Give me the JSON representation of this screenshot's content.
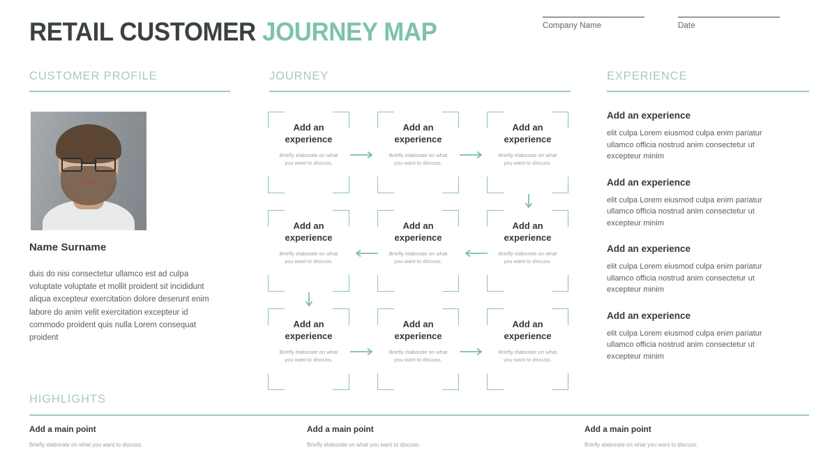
{
  "colors": {
    "accent": "#7dc3a8",
    "accent_line": "#9cccba",
    "bracket": "#8cc4ad",
    "heading_dark": "#3a4145",
    "body_text": "#555c60",
    "muted_text": "#9aa0a3",
    "background": "#ffffff"
  },
  "header": {
    "title_dark": "RETAIL CUSTOMER",
    "title_accent": "JOURNEY MAP",
    "fields": [
      {
        "label": "Company Name",
        "value": ""
      },
      {
        "label": "Date",
        "value": ""
      }
    ]
  },
  "profile": {
    "section_title": "CUSTOMER PROFILE",
    "photo_alt": "portrait-photo",
    "name": "Name Surname",
    "body": "duis do nisi consectetur ullamco est ad culpa voluptate voluptate et mollit proident sit incididunt aliqua excepteur exercitation dolore deserunt enim labore do anim velit exercitation excepteur id commodo proident quis nulla Lorem consequat proident"
  },
  "journey": {
    "section_title": "JOURNEY",
    "box_title": "Add an experience",
    "box_desc": "Briefly elaborate on what you want to discuss.",
    "boxes": [
      {
        "id": "j1",
        "title": "Add an experience",
        "desc": "Briefly elaborate on what you want to discuss."
      },
      {
        "id": "j2",
        "title": "Add an experience",
        "desc": "Briefly elaborate on what you want to discuss."
      },
      {
        "id": "j3",
        "title": "Add an experience",
        "desc": "Briefly elaborate on what you want to discuss."
      },
      {
        "id": "j4",
        "title": "Add an experience",
        "desc": "Briefly elaborate on what you want to discuss."
      },
      {
        "id": "j5",
        "title": "Add an experience",
        "desc": "Briefly elaborate on what you want to discuss."
      },
      {
        "id": "j6",
        "title": "Add an experience",
        "desc": "Briefly elaborate on what you want to discuss."
      },
      {
        "id": "j7",
        "title": "Add an experience",
        "desc": "Briefly elaborate on what you want to discuss."
      },
      {
        "id": "j8",
        "title": "Add an experience",
        "desc": "Briefly elaborate on what you want to discuss."
      },
      {
        "id": "j9",
        "title": "Add an experience",
        "desc": "Briefly elaborate on what you want to discuss."
      }
    ],
    "arrows": [
      {
        "name": "arrow-right-r1-1",
        "direction": "right"
      },
      {
        "name": "arrow-right-r1-2",
        "direction": "right"
      },
      {
        "name": "arrow-down-col3",
        "direction": "down"
      },
      {
        "name": "arrow-left-r2-1",
        "direction": "left"
      },
      {
        "name": "arrow-left-r2-2",
        "direction": "left"
      },
      {
        "name": "arrow-down-col1",
        "direction": "down"
      },
      {
        "name": "arrow-right-r3-1",
        "direction": "right"
      },
      {
        "name": "arrow-right-r3-2",
        "direction": "right"
      }
    ]
  },
  "experience": {
    "section_title": "EXPERIENCE",
    "items": [
      {
        "title": "Add an experience",
        "body": "elit culpa Lorem eiusmod culpa enim pariatur ullamco officia nostrud anim consectetur ut excepteur minim"
      },
      {
        "title": "Add an experience",
        "body": "elit culpa Lorem eiusmod culpa enim pariatur ullamco officia nostrud anim consectetur ut excepteur minim"
      },
      {
        "title": "Add an experience",
        "body": "elit culpa Lorem eiusmod culpa enim pariatur ullamco officia nostrud anim consectetur ut excepteur minim"
      },
      {
        "title": "Add an experience",
        "body": "elit culpa Lorem eiusmod culpa enim pariatur ullamco officia nostrud anim consectetur ut excepteur minim"
      }
    ]
  },
  "highlights": {
    "section_title": "HIGHLIGHTS",
    "items": [
      {
        "title": "Add a main point",
        "desc": "Briefly elaborate on what you want to discuss."
      },
      {
        "title": "Add a main point",
        "desc": "Briefly elaborate on what you want to discuss."
      },
      {
        "title": "Add a main point",
        "desc": "Briefly elaborate on what you want to discuss."
      }
    ]
  }
}
